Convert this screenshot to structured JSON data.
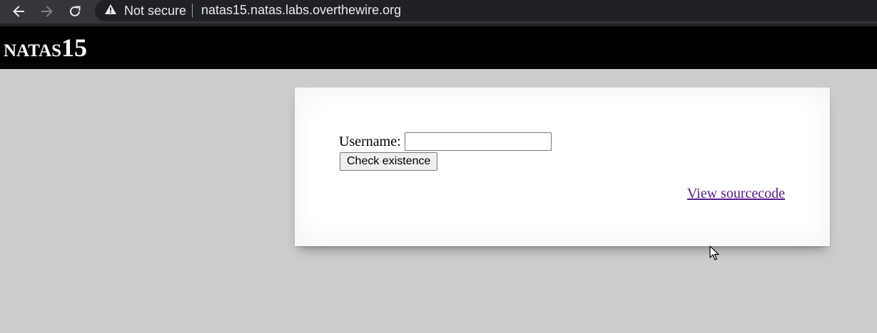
{
  "browser": {
    "security_label": "Not secure",
    "url": "natas15.natas.labs.overthewire.org"
  },
  "page": {
    "title": "natas15",
    "form": {
      "username_label": "Username:",
      "username_value": "",
      "submit_label": "Check existence"
    },
    "source_link_label": "View sourcecode"
  },
  "colors": {
    "page_background": "#cccccc",
    "banner_background": "#000000",
    "link_visited": "#551a8b"
  }
}
